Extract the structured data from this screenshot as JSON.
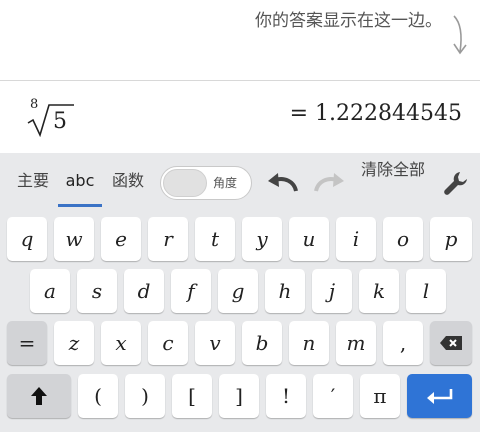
{
  "hint": {
    "text": "你的答案显示在这一边。"
  },
  "expression": {
    "root_index": "8",
    "radicand": "5",
    "result": "= 1.222844545"
  },
  "toolbar": {
    "tabs": [
      {
        "label": "主要"
      },
      {
        "label": "abc"
      },
      {
        "label": "函数"
      }
    ],
    "active_tab": "abc",
    "angle_label": "角度",
    "clear_label": "清除全部",
    "accent_color": "#3b73c6"
  },
  "keys": {
    "row1": [
      "q",
      "w",
      "e",
      "r",
      "t",
      "y",
      "u",
      "i",
      "o",
      "p"
    ],
    "row2": [
      "a",
      "s",
      "d",
      "f",
      "g",
      "h",
      "j",
      "k",
      "l"
    ],
    "row3": [
      "=",
      "z",
      "x",
      "c",
      "v",
      "b",
      "n",
      "m",
      ","
    ],
    "row4": [
      "(",
      ")",
      "[",
      "]",
      "!",
      "′",
      "π"
    ]
  },
  "icons": {
    "hint_arrow": "curved-down-arrow-icon",
    "undo": "undo-icon",
    "redo": "redo-icon",
    "settings": "wrench-icon",
    "backspace": "backspace-icon",
    "shift": "shift-up-arrow-icon",
    "enter": "enter-icon"
  },
  "colors": {
    "enter_key": "#2f74d6",
    "keyboard_bg": "#e8e9eb"
  }
}
